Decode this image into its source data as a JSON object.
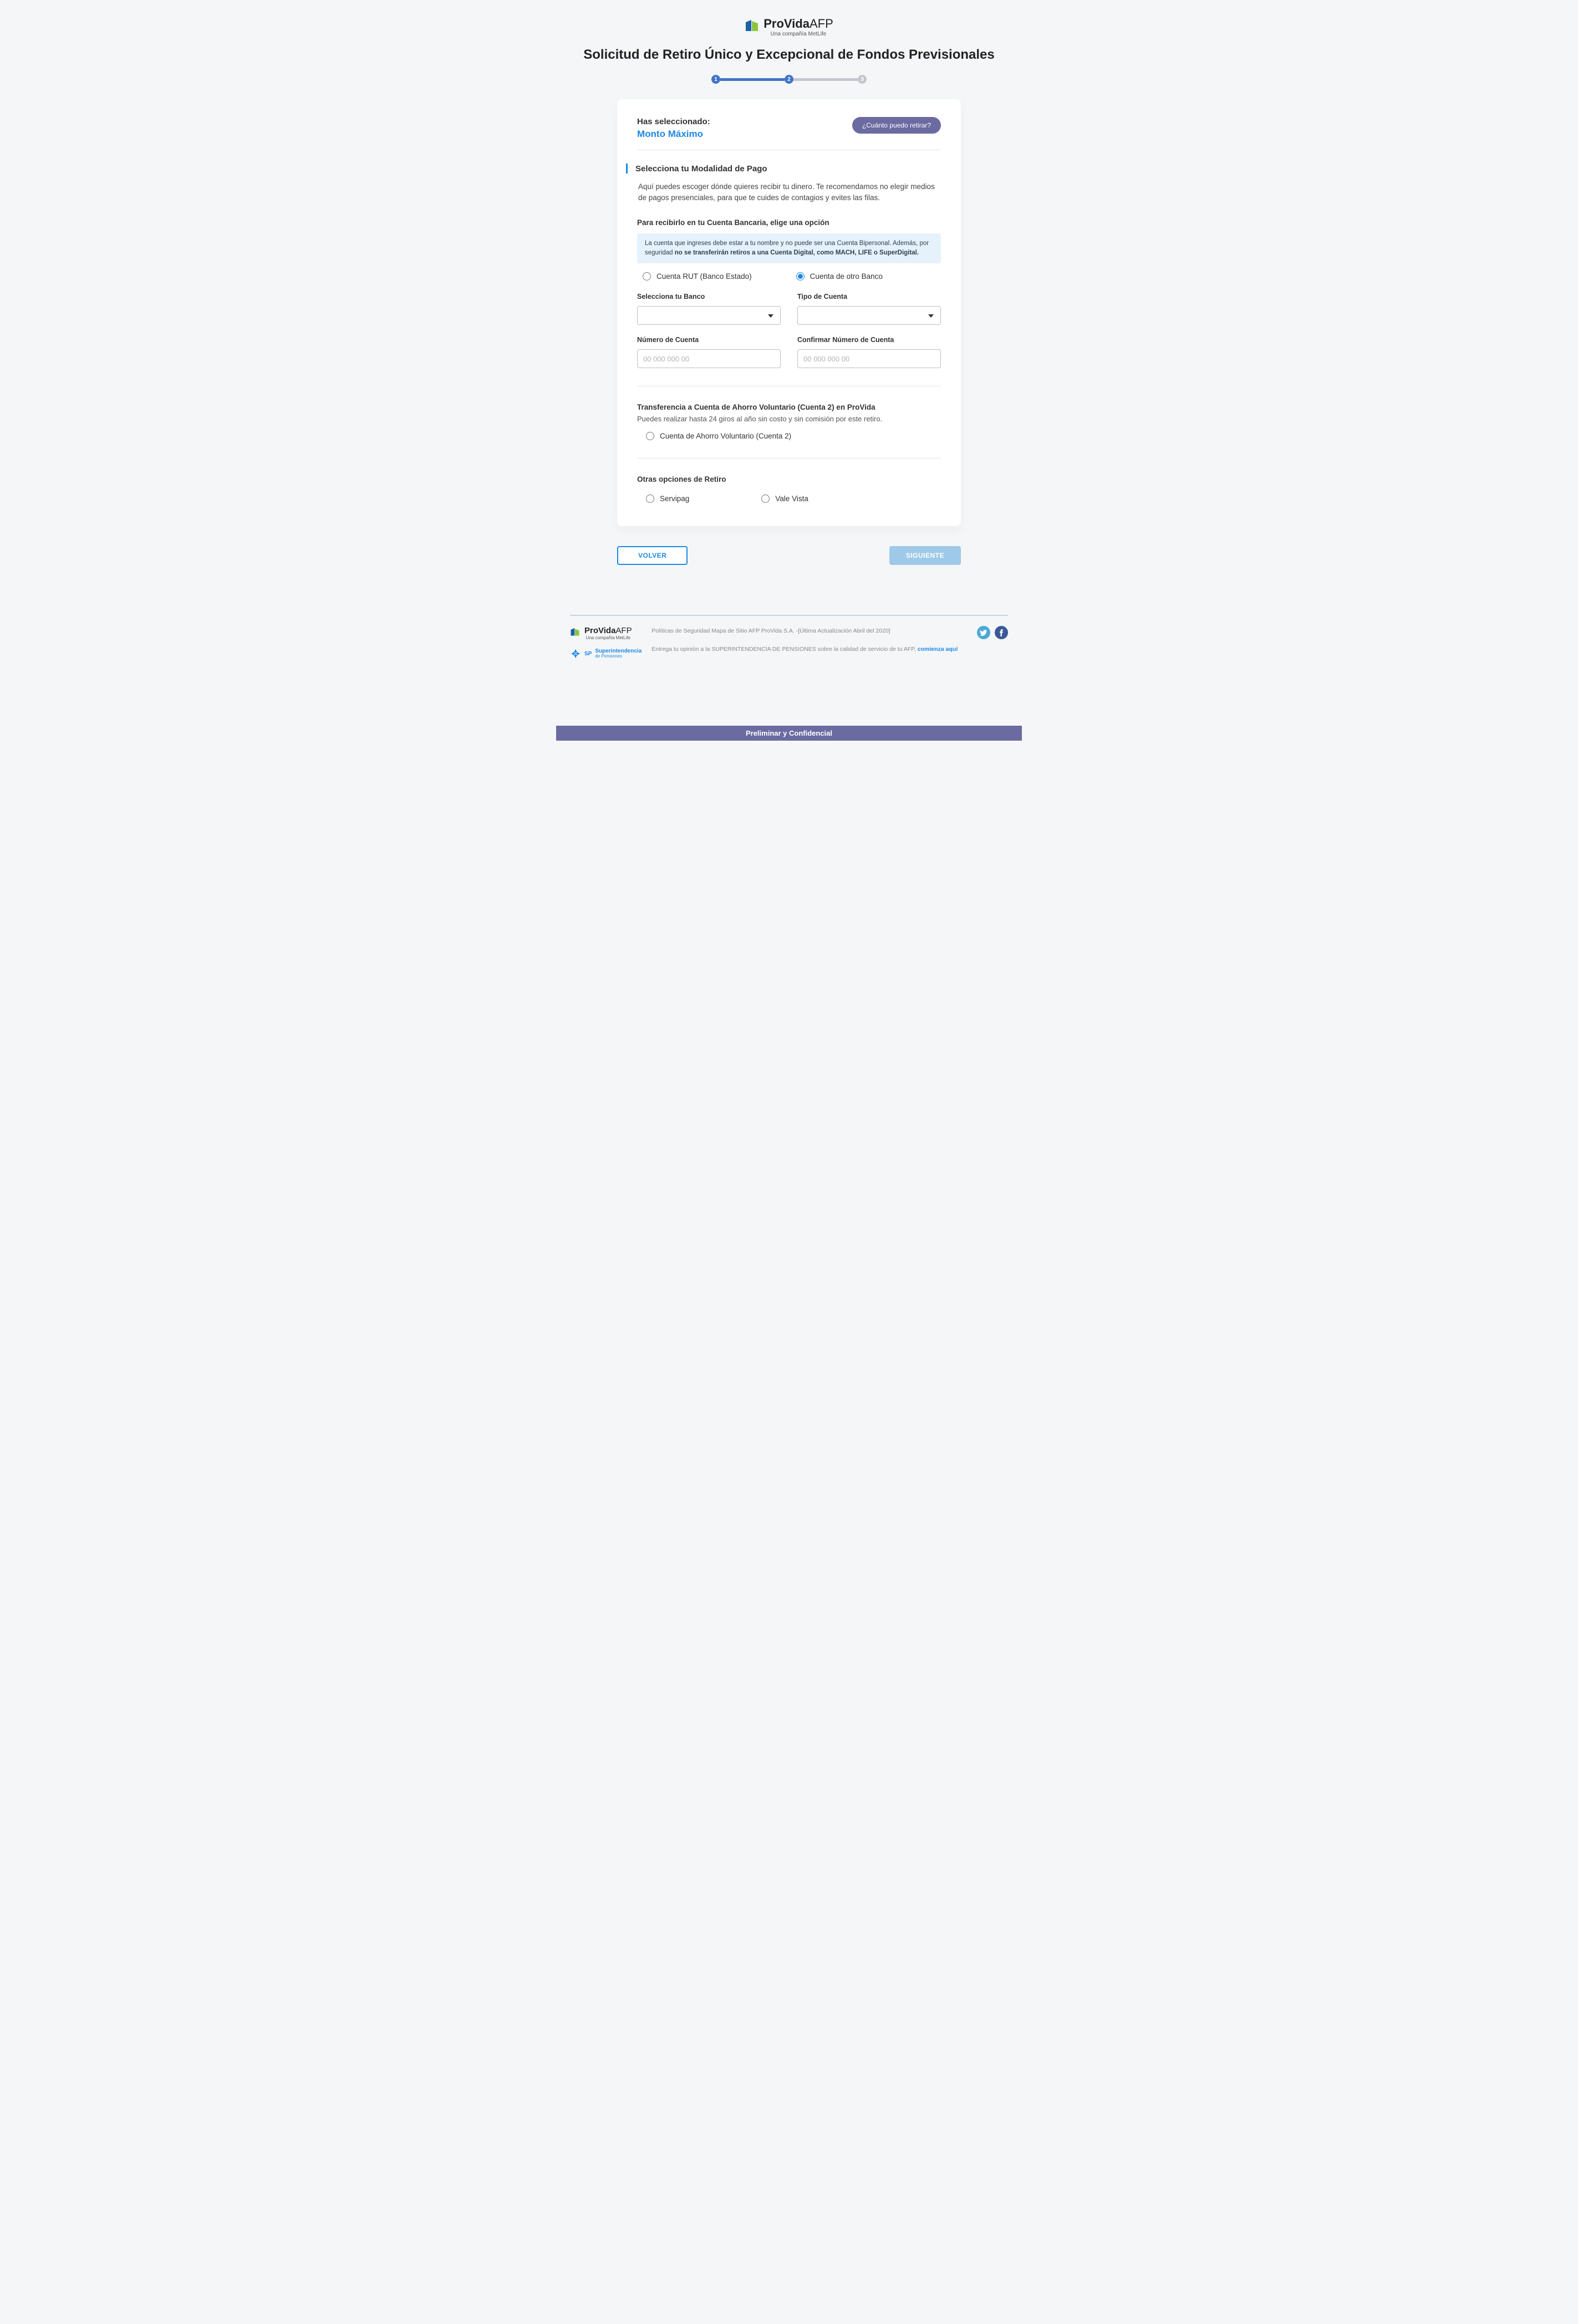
{
  "brand": {
    "name": "ProVida",
    "suffix": "AFP",
    "tagline": "Una compañía MetLife"
  },
  "page_title": "Solicitud de Retiro Único y Excepcional de Fondos Previsionales",
  "stepper": {
    "steps": [
      "1",
      "2",
      "3"
    ],
    "current": 2
  },
  "selection": {
    "label": "Has seleccionado:",
    "value": "Monto Máximo",
    "help_button": "¿Cuánto puedo retirar?"
  },
  "payment_mode": {
    "title": "Selecciona tu Modalidad de Pago",
    "description": "Aquí puedes escoger dónde quieres recibir tu dinero. Te recomendamos no elegir medios de pagos presenciales, para que te cuides de contagios y evites las filas."
  },
  "bank_section": {
    "heading": "Para recibirlo en tu Cuenta Bancaria, elige una opción",
    "info_text_1": "La cuenta que ingreses debe estar a tu nombre y no puede ser una Cuenta Bipersonal. Además, por seguridad ",
    "info_text_2": "no se transferirán retiros a una Cuenta Digital, como MACH, LIFE o SuperDigital.",
    "options": {
      "rut": "Cuenta RUT (Banco Estado)",
      "other": "Cuenta de otro Banco"
    },
    "selected_option": "other",
    "fields": {
      "bank_label": "Selecciona tu Banco",
      "account_type_label": "Tipo de Cuenta",
      "account_number_label": "Número de Cuenta",
      "confirm_number_label": "Confirmar Número de Cuenta",
      "number_placeholder": "00 000 000 00"
    }
  },
  "voluntary_section": {
    "heading": "Transferencia a Cuenta de Ahorro Voluntario (Cuenta 2) en ProVida",
    "description": "Puedes realizar hasta 24 giros al año sin costo y sin comisión por este retiro.",
    "option": "Cuenta de Ahorro Voluntario (Cuenta 2)"
  },
  "other_options": {
    "heading": "Otras opciones de Retiro",
    "servipag": "Servipag",
    "vale_vista": "Vale Vista"
  },
  "nav": {
    "back": "VOLVER",
    "next": "SIGUIENTE"
  },
  "footer": {
    "links_line": "Políticas de Seguridad  Mapa de Sitio  AFP ProVida S.A. -[Última Actualización Abril del 2020]",
    "opinion_line": "Entrega tu opinión a la SUPERINTENDENCIA DE PENSIONES sobre la calidad de servicio de tu AFP, ",
    "opinion_link": "comienza aquí",
    "sp_name": "Superintendencia",
    "sp_sub": "de Pensiones"
  },
  "bottom_bar": "Preliminar y Confidencial"
}
